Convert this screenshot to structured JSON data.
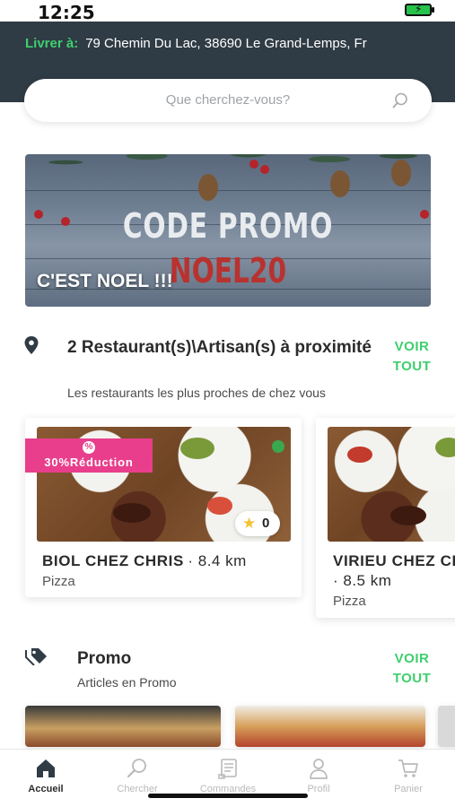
{
  "status_bar": {
    "time": "12:25"
  },
  "header": {
    "deliver_label": "Livrer à:",
    "deliver_address": "79 Chemin Du Lac, 38690 Le Grand-Lemps, Fr"
  },
  "search": {
    "placeholder": "Que cherchez-vous?"
  },
  "banner": {
    "promo_title": "CODE PROMO",
    "promo_code": "NOEL20",
    "caption": "C'EST NOEL !!!"
  },
  "nearby": {
    "title": "2 Restaurant(s)\\Artisan(s) à proximité",
    "subtitle": "Les restaurants les plus proches de chez vous",
    "see_all_line1": "VOIR",
    "see_all_line2": "TOUT",
    "restaurants": [
      {
        "name": "BIOL CHEZ CHRIS",
        "distance": "· 8.4 km",
        "category": "Pizza",
        "discount": "30%Réduction",
        "rating": "0"
      },
      {
        "name": "VIRIEU CHEZ CHRIS",
        "distance": "· 8.5 km",
        "category": "Pizza"
      }
    ]
  },
  "promo": {
    "title": "Promo",
    "subtitle": "Articles en Promo",
    "see_all_line1": "VOIR",
    "see_all_line2": "TOUT"
  },
  "bottom_nav": {
    "items": [
      {
        "label": "Accueil",
        "icon": "home-icon",
        "active": true
      },
      {
        "label": "Chercher",
        "icon": "search-icon",
        "active": false
      },
      {
        "label": "Commandes",
        "icon": "orders-icon",
        "active": false
      },
      {
        "label": "Profil",
        "icon": "profile-icon",
        "active": false
      },
      {
        "label": "Panier",
        "icon": "cart-icon",
        "active": false
      }
    ]
  },
  "colors": {
    "header_bg": "#2f3b45",
    "accent_green": "#3ecf6e",
    "discount_pink": "#e83e8c",
    "star_yellow": "#f2c230"
  }
}
